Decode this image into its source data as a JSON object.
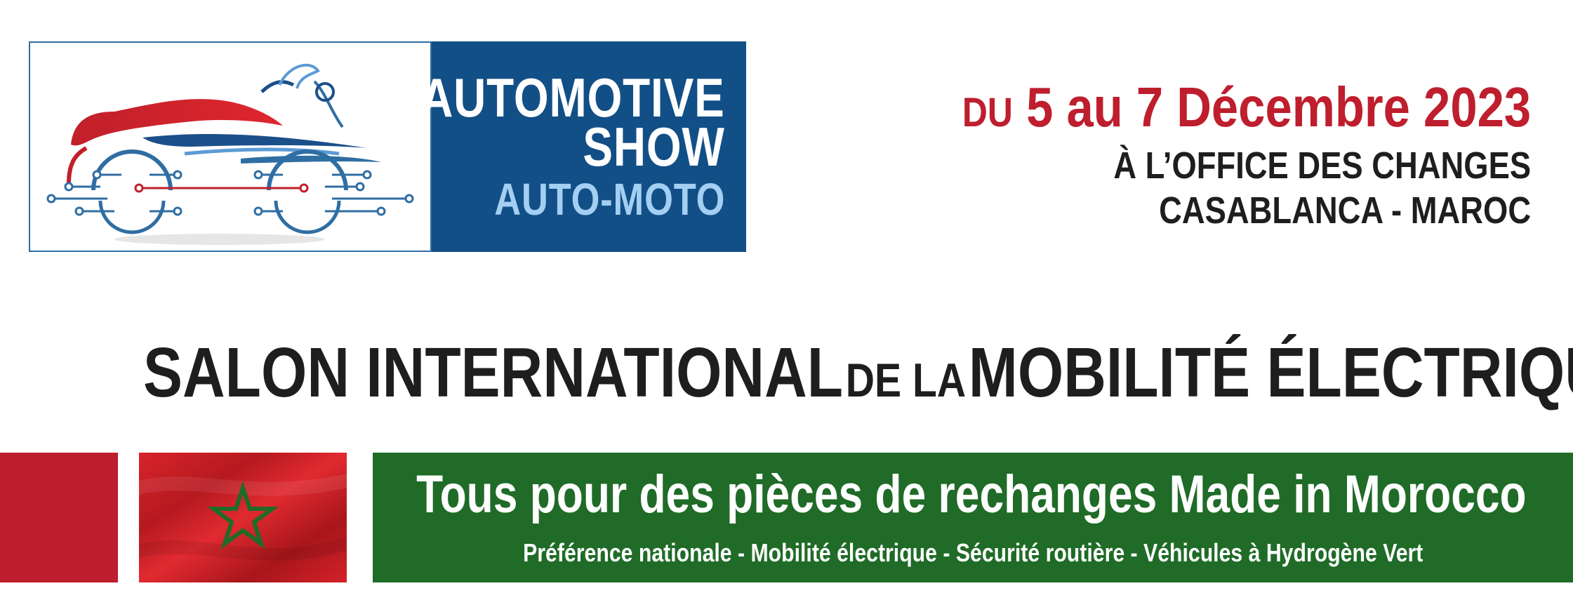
{
  "logo": {
    "line1": "AUTOMOTIVE",
    "line2": "SHOW",
    "line3": "AUTO-MOTO",
    "icon": "car-moto-circuit-logo",
    "colors": {
      "panel": "#124f87",
      "accent_red": "#be1e2d",
      "light_blue": "#a3cff2"
    }
  },
  "event": {
    "date_prefix": "DU",
    "date_main": "5 au 7 Décembre 2023",
    "venue": "À L’OFFICE DES CHANGES",
    "city": "CASABLANCA - MAROC"
  },
  "headline": {
    "part1": "SALON INTERNATIONAL",
    "part2": "DE LA",
    "part3": "MOBILITÉ ÉLECTRIQUE"
  },
  "banner": {
    "flag_icon": "morocco-flag",
    "tagline": "Tous pour des pièces de rechanges Made in Morocco",
    "subline": "Préférence nationale - Mobilité électrique - Sécurité routière - Véhicules à Hydrogène Vert",
    "colors": {
      "green": "#1f6b27",
      "red": "#be1e2d"
    }
  }
}
